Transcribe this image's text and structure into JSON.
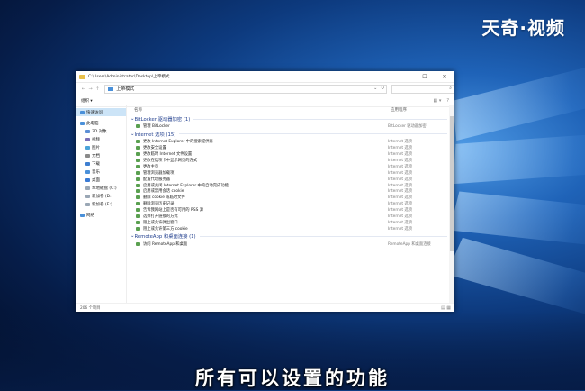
{
  "watermark": "天奇·视频",
  "subtitle": "所有可以设置的功能",
  "window": {
    "title": "C:\\Users\\Administrator\\Desktop\\上帝模式",
    "minimize_glyph": "—",
    "maximize_glyph": "☐",
    "close_glyph": "✕"
  },
  "address": {
    "path": "上帝模式",
    "back_glyph": "←",
    "forward_glyph": "→",
    "up_glyph": "↑",
    "dropdown_glyph": "⌄",
    "refresh_glyph": "↻",
    "search_glyph": "⌕"
  },
  "toolbar": {
    "organize": "组织 ▾",
    "view_glyph": "▦ ▾",
    "help_glyph": "?"
  },
  "columns": {
    "name": "名称",
    "category": "应用程序"
  },
  "sidebar": [
    {
      "label": "快速访问",
      "color": "#4a90d9"
    },
    {
      "label": "此电脑",
      "color": "#4a90d9"
    },
    {
      "label": "3D 对象",
      "color": "#5c8fd6"
    },
    {
      "label": "视频",
      "color": "#7a6fb8"
    },
    {
      "label": "图片",
      "color": "#4aa3d9"
    },
    {
      "label": "文档",
      "color": "#8a8a8a"
    },
    {
      "label": "下载",
      "color": "#3f7fd1"
    },
    {
      "label": "音乐",
      "color": "#4a90d9"
    },
    {
      "label": "桌面",
      "color": "#3a7bd5"
    },
    {
      "label": "本地磁盘 (C:)",
      "color": "#9aa7b5"
    },
    {
      "label": "新加卷 (D:)",
      "color": "#9aa7b5"
    },
    {
      "label": "新加卷 (E:)",
      "color": "#9aa7b5"
    },
    {
      "label": "网络",
      "color": "#4a90d9"
    }
  ],
  "groups": [
    {
      "title": "BitLocker 驱动器加密 (1)",
      "items": [
        {
          "name": "管理 BitLocker",
          "category": "BitLocker 驱动器加密"
        }
      ]
    },
    {
      "title": "Internet 选项 (15)",
      "items": [
        {
          "name": "更改 Internet Explorer 中的搜索提供商",
          "category": "Internet 选项"
        },
        {
          "name": "更改安全设置",
          "category": "Internet 选项"
        },
        {
          "name": "更改临时 Internet 文件设置",
          "category": "Internet 选项"
        },
        {
          "name": "更改在选项卡中显示网页的方式",
          "category": "Internet 选项"
        },
        {
          "name": "更改主页",
          "category": "Internet 选项"
        },
        {
          "name": "管理浏览器加载项",
          "category": "Internet 选项"
        },
        {
          "name": "配置代理服务器",
          "category": "Internet 选项"
        },
        {
          "name": "启用或关闭 Internet Explorer 中的自动完成功能",
          "category": "Internet 选项"
        },
        {
          "name": "启用或禁用会话 cookie",
          "category": "Internet 选项"
        },
        {
          "name": "删除 cookie 或临时文件",
          "category": "Internet 选项"
        },
        {
          "name": "删除浏览历史记录",
          "category": "Internet 选项"
        },
        {
          "name": "告诉我网站上是否有可用的 RSS 源",
          "category": "Internet 选项"
        },
        {
          "name": "选择打开链接的方式",
          "category": "Internet 选项"
        },
        {
          "name": "阻止或允许弹出窗口",
          "category": "Internet 选项"
        },
        {
          "name": "阻止或允许第三方 cookie",
          "category": "Internet 选项"
        }
      ]
    },
    {
      "title": "RemoteApp 和桌面连接 (1)",
      "items": [
        {
          "name": "访问 RemoteApp 和桌面",
          "category": "RemoteApp 和桌面连接"
        }
      ]
    }
  ],
  "status": {
    "count": "206 个项目",
    "view_glyph": "▤ ▦"
  }
}
